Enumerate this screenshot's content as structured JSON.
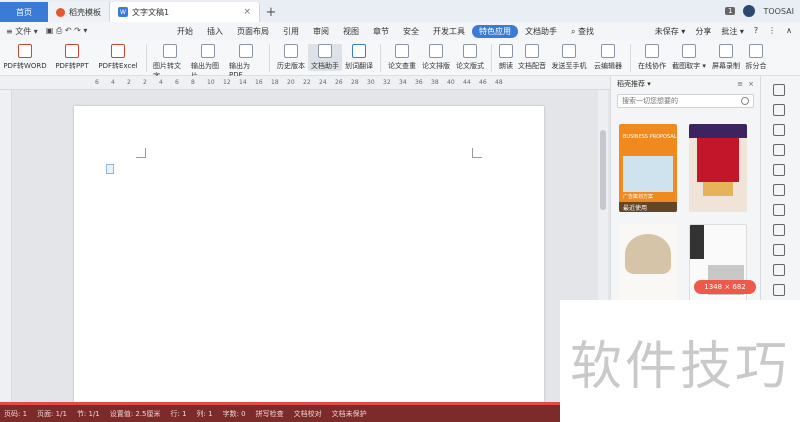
{
  "titlebar": {
    "tabs": [
      {
        "label": "首页"
      },
      {
        "label": "稻壳模板"
      },
      {
        "label": "文字文稿1"
      }
    ],
    "badge": "1",
    "user": "TOOSAI"
  },
  "menubar": {
    "file_label": "≡ 文件 ▾",
    "items": [
      "开始",
      "插入",
      "页面布局",
      "引用",
      "审阅",
      "视图",
      "章节",
      "安全",
      "开发工具",
      "特色应用",
      "文档助手"
    ],
    "search_label": "查找",
    "right": [
      "未保存 ▾",
      "分享",
      "批注 ▾"
    ]
  },
  "ribbon": {
    "buttons": [
      "PDF转WORD",
      "PDF转PPT",
      "PDF转Excel",
      "图片转文字",
      "输出为图片",
      "输出为PDF",
      "历史版本",
      "文档助手",
      "划词翻译",
      "论文查重",
      "论文排版",
      "论文版式",
      "朗读",
      "文档配音",
      "发送至手机",
      "云编辑器",
      "在线协作",
      "截图取字 ▾",
      "屏幕录制",
      "拆分合"
    ]
  },
  "ruler": {
    "ticks": [
      "6",
      "4",
      "2",
      "2",
      "4",
      "6",
      "8",
      "10",
      "12",
      "14",
      "16",
      "18",
      "20",
      "22",
      "24",
      "26",
      "28",
      "30",
      "32",
      "34",
      "36",
      "38",
      "40",
      "44",
      "46",
      "48"
    ]
  },
  "panel": {
    "title": "稻壳推荐 ▾",
    "search_placeholder": "搜索一切您想要的",
    "t1_text": "BUSINESS PROPOSAL",
    "t1_sub": "广告策划方案",
    "recent_label": "最近使用",
    "zoom_chip": "1348 × 682"
  },
  "statusbar": {
    "items": [
      "页码: 1",
      "页面: 1/1",
      "节: 1/1",
      "设置值: 2.5厘米",
      "行: 1",
      "列: 1",
      "字数: 0",
      "拼写检查",
      "文档校对",
      "文档未保护"
    ]
  },
  "watermark": "软件技巧",
  "colors": {
    "accent": "#3a7bd5",
    "status_bar": "#7d2a2a",
    "status_border": "#e24a4a"
  }
}
